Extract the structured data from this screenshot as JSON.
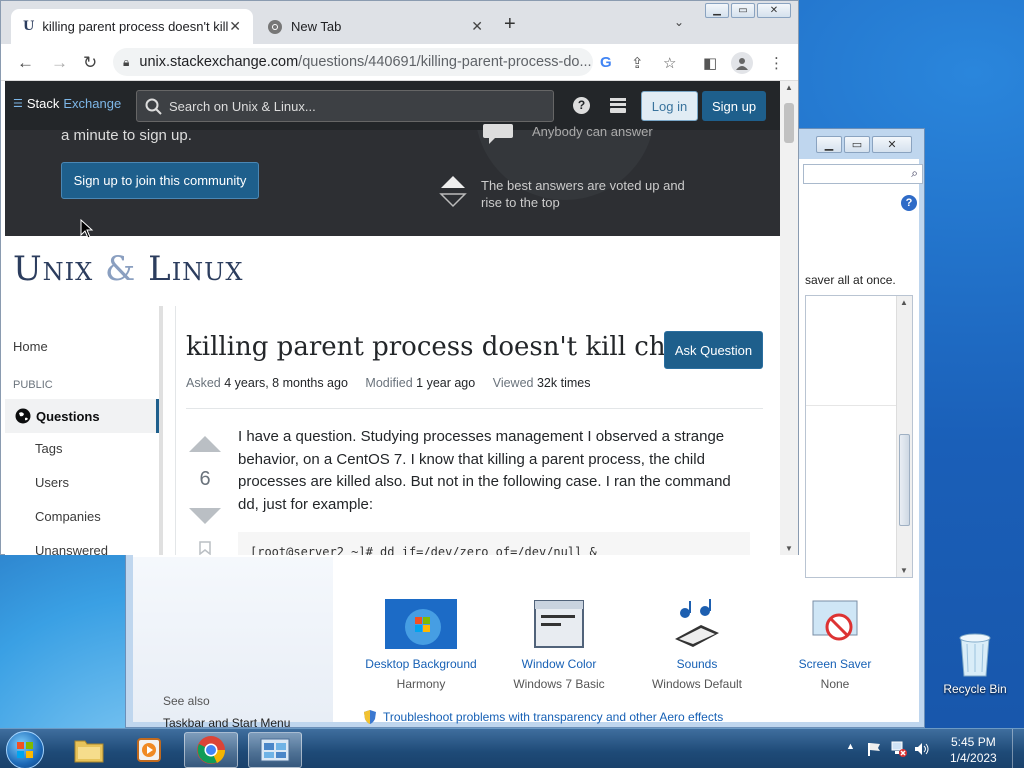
{
  "browser": {
    "tabs": [
      {
        "title": "killing parent process doesn't kill"
      },
      {
        "title": "New Tab"
      }
    ],
    "url_host": "unix.stackexchange.com",
    "url_path": "/questions/440691/killing-parent-process-do..."
  },
  "se": {
    "logo_stack": "Stack",
    "logo_exchange": "Exchange",
    "search_placeholder": "Search on Unix & Linux...",
    "login": "Log in",
    "signup": "Sign up",
    "hero_minute": "a minute to sign up.",
    "hero_join": "Sign up to join this community",
    "hero_anybody": "Anybody can answer",
    "hero_best": "The best answers are voted up and rise to the top",
    "site_unix": "Unix",
    "site_amp": "&",
    "site_linux": "Linux"
  },
  "nav": {
    "home": "Home",
    "public": "PUBLIC",
    "questions": "Questions",
    "tags": "Tags",
    "users": "Users",
    "companies": "Companies",
    "unanswered": "Unanswered"
  },
  "question": {
    "title": "killing parent process doesn't kill child",
    "ask_button": "Ask Question",
    "asked_label": "Asked",
    "asked_value": "4 years, 8 months ago",
    "modified_label": "Modified",
    "modified_value": "1 year ago",
    "viewed_label": "Viewed",
    "viewed_value": "32k times",
    "votes": "6",
    "body": "I have a question. Studying processes management I observed a strange behavior, on a CentOS 7. I know that killing a parent process, the child processes are killed also. But not in the following case. I ran the command dd, just for example:",
    "code": "[root@server2 ~]# dd if=/dev/zero of=/dev/null &"
  },
  "control_panel": {
    "theme_text": "saver all at once.",
    "see_also": "See also",
    "taskbar_link": "Taskbar and Start Menu",
    "items": [
      {
        "title": "Desktop Background",
        "value": "Harmony"
      },
      {
        "title": "Window Color",
        "value": "Windows 7 Basic"
      },
      {
        "title": "Sounds",
        "value": "Windows Default"
      },
      {
        "title": "Screen Saver",
        "value": "None"
      }
    ],
    "troubleshoot": "Troubleshoot problems with transparency and other Aero effects"
  },
  "desktop": {
    "recycle_bin": "Recycle Bin"
  },
  "taskbar": {
    "time": "5:45 PM",
    "date": "1/4/2023"
  },
  "colors": {
    "se_blue": "#1e5f8c",
    "link_blue": "#1660b5"
  }
}
